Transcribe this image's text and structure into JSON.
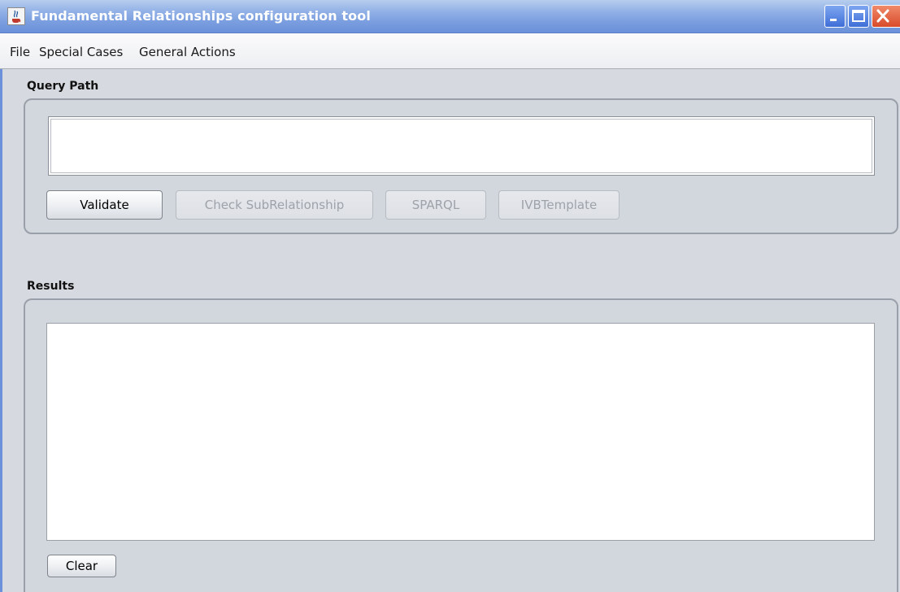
{
  "window": {
    "title": "Fundamental Relationships configuration tool",
    "icon": "java-cup-icon"
  },
  "menubar": {
    "items": [
      {
        "label": "File"
      },
      {
        "label": "Special Cases"
      },
      {
        "label": "General Actions"
      }
    ]
  },
  "query_section": {
    "label": "Query Path",
    "input_value": "",
    "buttons": {
      "validate": {
        "label": "Validate",
        "enabled": true
      },
      "check_subrelationship": {
        "label": "Check SubRelationship",
        "enabled": false
      },
      "sparql": {
        "label": "SPARQL",
        "enabled": false
      },
      "ivb_template": {
        "label": "IVBTemplate",
        "enabled": false
      }
    }
  },
  "results_section": {
    "label": "Results",
    "content": "",
    "clear_button": {
      "label": "Clear",
      "enabled": true
    }
  },
  "colors": {
    "titlebar": "#7b9fdf",
    "window_bg": "#d6d9df",
    "close_button": "#d84b2a"
  }
}
